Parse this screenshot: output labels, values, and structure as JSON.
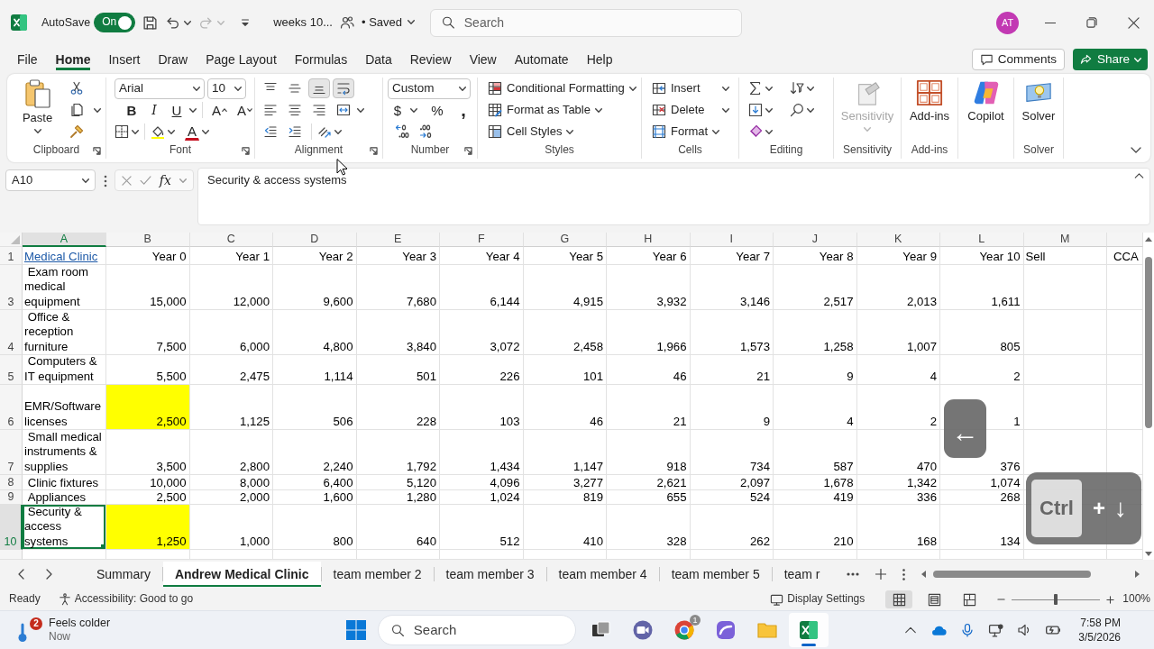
{
  "title_bar": {
    "autosave_label": "AutoSave",
    "autosave_toggle": {
      "label": "On",
      "on": true
    },
    "undo": {
      "disabled": false
    },
    "redo": {
      "disabled": true
    },
    "document_title": "weeks 10...",
    "save_status": "• Saved",
    "search": {
      "placeholder": "Search"
    },
    "avatar": "AT"
  },
  "menu": {
    "tabs": [
      {
        "label": "File",
        "selected": false
      },
      {
        "label": "Home",
        "selected": true
      },
      {
        "label": "Insert",
        "selected": false
      },
      {
        "label": "Draw",
        "selected": false
      },
      {
        "label": "Page Layout",
        "selected": false
      },
      {
        "label": "Formulas",
        "selected": false
      },
      {
        "label": "Data",
        "selected": false
      },
      {
        "label": "Review",
        "selected": false
      },
      {
        "label": "View",
        "selected": false
      },
      {
        "label": "Automate",
        "selected": false
      },
      {
        "label": "Help",
        "selected": false
      }
    ],
    "comments": "Comments",
    "share": "Share"
  },
  "ribbon": {
    "clipboard": {
      "paste": "Paste",
      "label": "Clipboard"
    },
    "font": {
      "family": "Arial",
      "size": "10",
      "bold": "B",
      "italic": "I",
      "underline": "U",
      "grow": "A",
      "shrink": "A",
      "color_button": "A",
      "label": "Font"
    },
    "alignment": {
      "vertical": [
        {
          "selected": false
        },
        {
          "selected": false
        },
        {
          "selected": true
        }
      ],
      "wrap_text": {
        "on": true
      },
      "label": "Alignment"
    },
    "number": {
      "format": "Custom",
      "currency": "$",
      "percent": "%",
      "comma": ",",
      "label": "Number"
    },
    "styles": {
      "buttons": [
        "Conditional Formatting",
        "Format as Table",
        "Cell Styles"
      ],
      "label": "Styles"
    },
    "cells": {
      "buttons": [
        "Insert",
        "Delete",
        "Format"
      ],
      "label": "Cells"
    },
    "editing": {
      "label": "Editing"
    },
    "sensitivity": {
      "button": "Sensitivity",
      "disabled": true,
      "label": "Sensitivity"
    },
    "add_ins": {
      "button": "Add-ins",
      "label": "Add-ins"
    },
    "copilot": {
      "button": "Copilot"
    },
    "solver": {
      "button": "Solver",
      "label": "Solver"
    }
  },
  "formula_bar": {
    "name_box": "A10",
    "function_button": "fx",
    "formula": "Security & access systems"
  },
  "sheet": {
    "columns": [
      {
        "label": "A",
        "selected": true
      },
      {
        "label": "B",
        "selected": false
      },
      {
        "label": "C",
        "selected": false
      },
      {
        "label": "D",
        "selected": false
      },
      {
        "label": "E",
        "selected": false
      },
      {
        "label": "F",
        "selected": false
      },
      {
        "label": "G",
        "selected": false
      },
      {
        "label": "H",
        "selected": false
      },
      {
        "label": "I",
        "selected": false
      },
      {
        "label": "J",
        "selected": false
      },
      {
        "label": "K",
        "selected": false
      },
      {
        "label": "L",
        "selected": false
      },
      {
        "label": "M",
        "selected": false
      }
    ],
    "rows": [
      {
        "number": "1",
        "selected": false,
        "cells": [
          {
            "text": "Medical Clinic",
            "kind": "link"
          },
          "Year 0",
          "Year 1",
          "Year 2",
          "Year 3",
          "Year 4",
          "Year 5",
          "Year 6",
          "Year 7",
          "Year 8",
          "Year 9",
          "Year 10",
          "Sell",
          "CCA"
        ]
      },
      {
        "number": "3",
        "selected": false,
        "cells": [
          " Exam room medical equipment",
          "15,000",
          "12,000",
          "9,600",
          "7,680",
          "6,144",
          "4,915",
          "3,932",
          "3,146",
          "2,517",
          "2,013",
          "1,611"
        ]
      },
      {
        "number": "4",
        "selected": false,
        "cells": [
          " Office & reception furniture",
          "7,500",
          "6,000",
          "4,800",
          "3,840",
          "3,072",
          "2,458",
          "1,966",
          "1,573",
          "1,258",
          "1,007",
          "805"
        ]
      },
      {
        "number": "5",
        "selected": false,
        "cells": [
          " Computers & IT equipment",
          "5,500",
          "2,475",
          "1,114",
          "501",
          "226",
          "101",
          "46",
          "21",
          "9",
          "4",
          "2"
        ]
      },
      {
        "number": "6",
        "selected": false,
        "cells": [
          "EMR/Software licenses",
          {
            "text": "2,500",
            "highlighted": true
          },
          "1,125",
          "506",
          "228",
          "103",
          "46",
          "21",
          "9",
          "4",
          "2",
          "1"
        ]
      },
      {
        "number": "7",
        "selected": false,
        "cells": [
          " Small medical instruments & supplies",
          "3,500",
          "2,800",
          "2,240",
          "1,792",
          "1,434",
          "1,147",
          "918",
          "734",
          "587",
          "470",
          "376"
        ]
      },
      {
        "number": "8",
        "selected": false,
        "cells": [
          " Clinic fixtures",
          "10,000",
          "8,000",
          "6,400",
          "5,120",
          "4,096",
          "3,277",
          "2,621",
          "2,097",
          "1,678",
          "1,342",
          "1,074"
        ]
      },
      {
        "number": "9",
        "selected": false,
        "cells": [
          " Appliances",
          "2,500",
          "2,000",
          "1,600",
          "1,280",
          "1,024",
          "819",
          "655",
          "524",
          "419",
          "336",
          "268"
        ]
      },
      {
        "number": "10",
        "selected": true,
        "cells": [
          " Security & access systems",
          {
            "text": "1,250",
            "highlighted": true
          },
          "1,000",
          "800",
          "640",
          "512",
          "410",
          "328",
          "262",
          "210",
          "168",
          "134"
        ]
      }
    ]
  },
  "key_overlay": {
    "single_key": "←",
    "combo": {
      "modifier": "Ctrl",
      "plus": "+",
      "key": "↓"
    }
  },
  "sheet_tabs": {
    "tabs": [
      {
        "label": "Summary",
        "selected": false
      },
      {
        "label": "Andrew Medical Clinic",
        "selected": true
      },
      {
        "label": "team member 2",
        "selected": false
      },
      {
        "label": "team member 3",
        "selected": false
      },
      {
        "label": "team member 4",
        "selected": false
      },
      {
        "label": "team member 5",
        "selected": false
      },
      {
        "label": "team r",
        "selected": false
      }
    ]
  },
  "status_bar": {
    "mode": "Ready",
    "accessibility": "Accessibility: Good to go",
    "display_settings": "Display Settings",
    "views": [
      {
        "selected": true
      },
      {
        "selected": false
      },
      {
        "selected": false
      }
    ],
    "zoom": {
      "level": 0.5,
      "reading": "100%"
    }
  },
  "taskbar": {
    "weather": {
      "badge": "2",
      "title": "Feels colder",
      "subtitle": "Now"
    },
    "search": {
      "placeholder": "Search"
    },
    "apps": [
      {
        "kind": "taskview",
        "selected": false
      },
      {
        "kind": "chat",
        "selected": false
      },
      {
        "kind": "browser",
        "selected": false,
        "badge": "1"
      },
      {
        "kind": "office",
        "selected": false
      },
      {
        "kind": "folder",
        "selected": false
      },
      {
        "kind": "spreadsheet",
        "selected": true
      }
    ],
    "clock": {
      "time": "7:58 PM",
      "date": "3/5/2026"
    }
  }
}
